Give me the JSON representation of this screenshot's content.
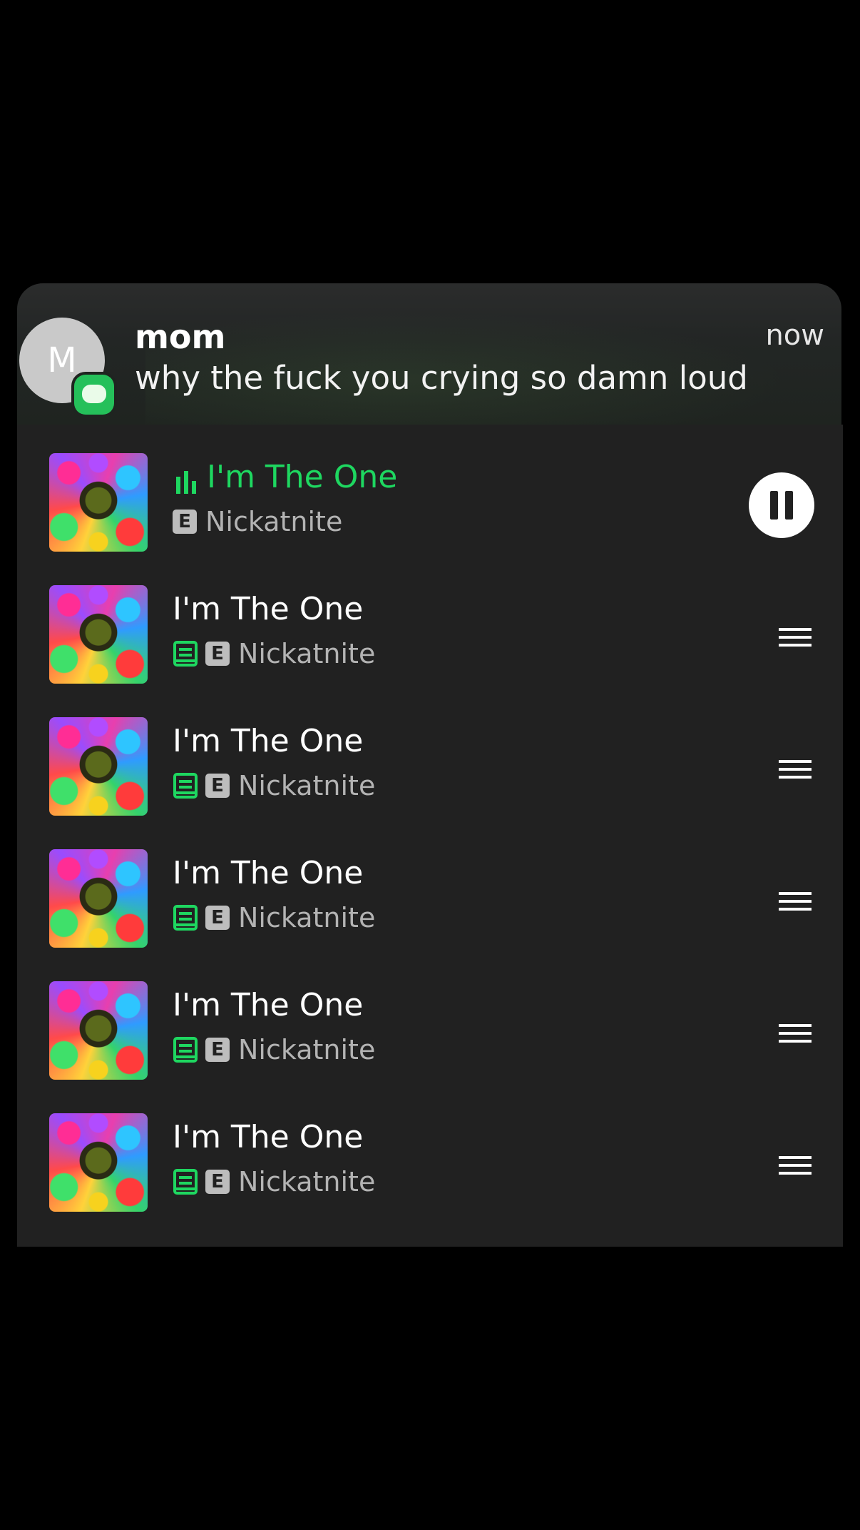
{
  "notification": {
    "avatar_initial": "M",
    "sender": "mom",
    "message": "why the fuck you crying so damn loud",
    "time": "now",
    "app_icon": "messages-icon"
  },
  "queue": {
    "accent_color": "#1ed760",
    "items": [
      {
        "title": "I'm The One",
        "explicit": "E",
        "artist": "Nickatnite",
        "playing": true
      },
      {
        "title": "I'm The One",
        "explicit": "E",
        "artist": "Nickatnite",
        "downloaded": true
      },
      {
        "title": "I'm The One",
        "explicit": "E",
        "artist": "Nickatnite",
        "downloaded": true
      },
      {
        "title": "I'm The One",
        "explicit": "E",
        "artist": "Nickatnite",
        "downloaded": true
      },
      {
        "title": "I'm The One",
        "explicit": "E",
        "artist": "Nickatnite",
        "downloaded": true
      },
      {
        "title": "I'm The One",
        "explicit": "E",
        "artist": "Nickatnite",
        "downloaded": true
      }
    ]
  }
}
